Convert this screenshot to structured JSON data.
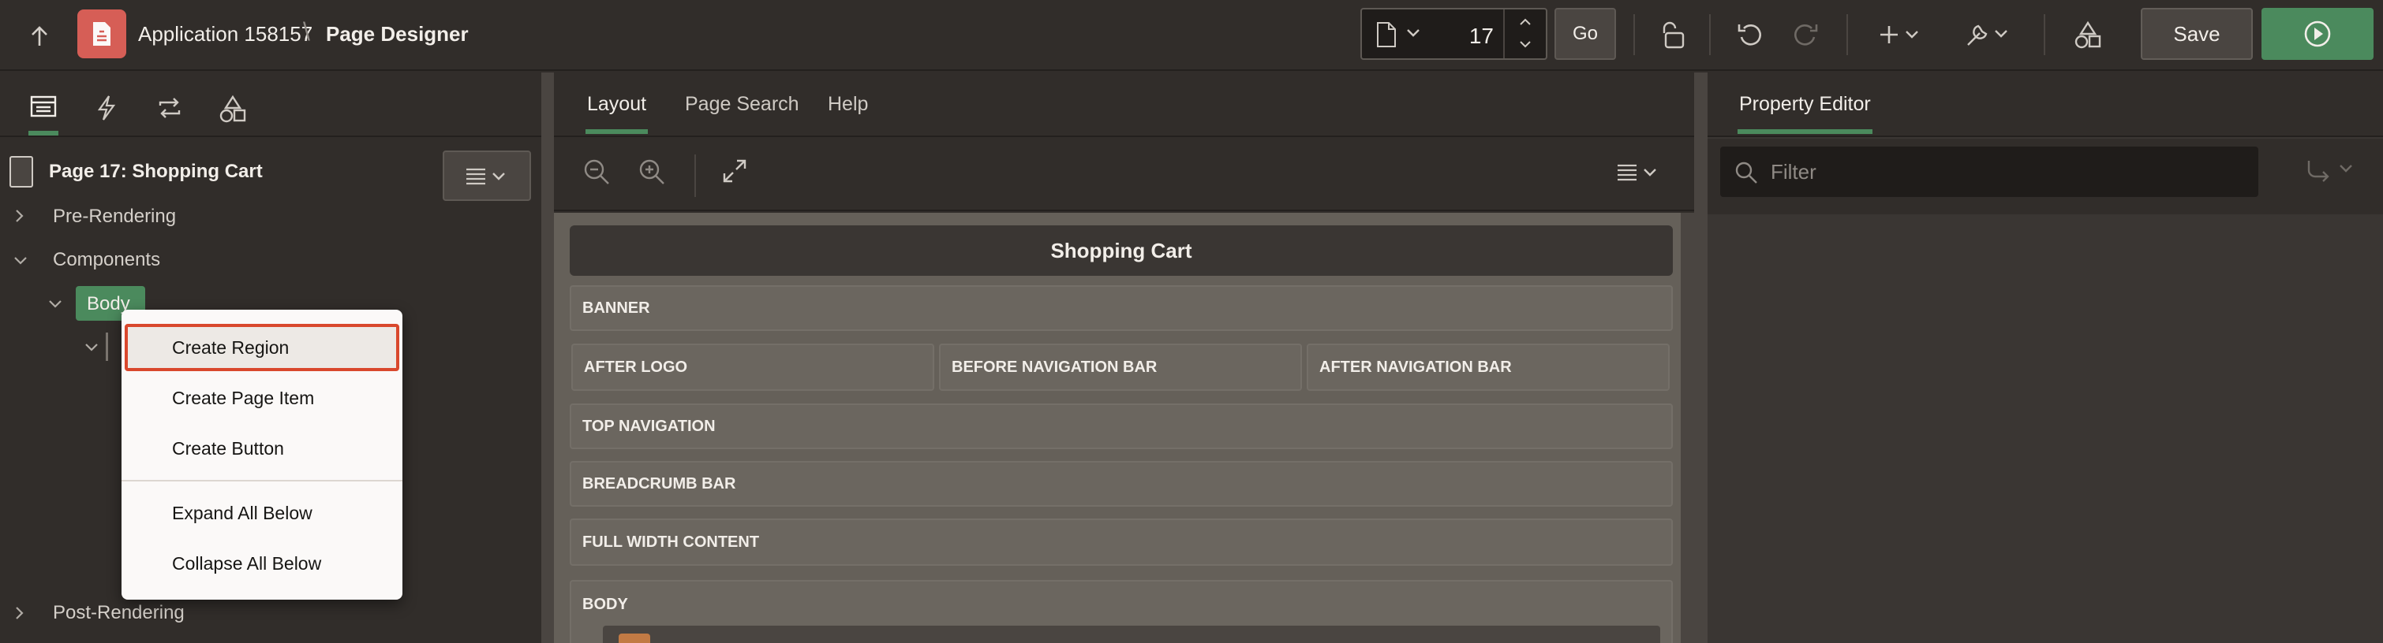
{
  "header": {
    "app_name": "Application 158157",
    "separator": "\\",
    "page_title": "Page Designer",
    "page_number": "17",
    "go_label": "Go",
    "save_label": "Save"
  },
  "left_panel": {
    "tabs": [
      "rendering-tab",
      "dynamic-actions-tab",
      "processing-tab",
      "shared-components-tab"
    ],
    "tree": {
      "root": "Page 17: Shopping Cart",
      "pre_rendering": "Pre-Rendering",
      "components": "Components",
      "body": "Body",
      "post_rendering": "Post-Rendering"
    }
  },
  "center_panel": {
    "tabs": [
      "Layout",
      "Page Search",
      "Help"
    ],
    "active_tab": "Layout",
    "page_header": "Shopping Cart",
    "slots": {
      "banner": "BANNER",
      "after_logo": "AFTER LOGO",
      "before_navigation_bar": "BEFORE NAVIGATION BAR",
      "after_navigation_bar": "AFTER NAVIGATION BAR",
      "top_navigation": "TOP NAVIGATION",
      "breadcrumb_bar": "BREADCRUMB BAR",
      "full_width_content": "FULL WIDTH CONTENT",
      "body": "BODY"
    }
  },
  "right_panel": {
    "tab": "Property Editor",
    "filter_placeholder": "Filter"
  },
  "context_menu": {
    "items": [
      "Create Region",
      "Create Page Item",
      "Create Button",
      "Expand All Below",
      "Collapse All Below"
    ],
    "focused_index": 0
  },
  "colors": {
    "accent_green": "#4b8a5d",
    "app_icon_red": "#d65e56",
    "focus_outline": "#d9482d"
  }
}
